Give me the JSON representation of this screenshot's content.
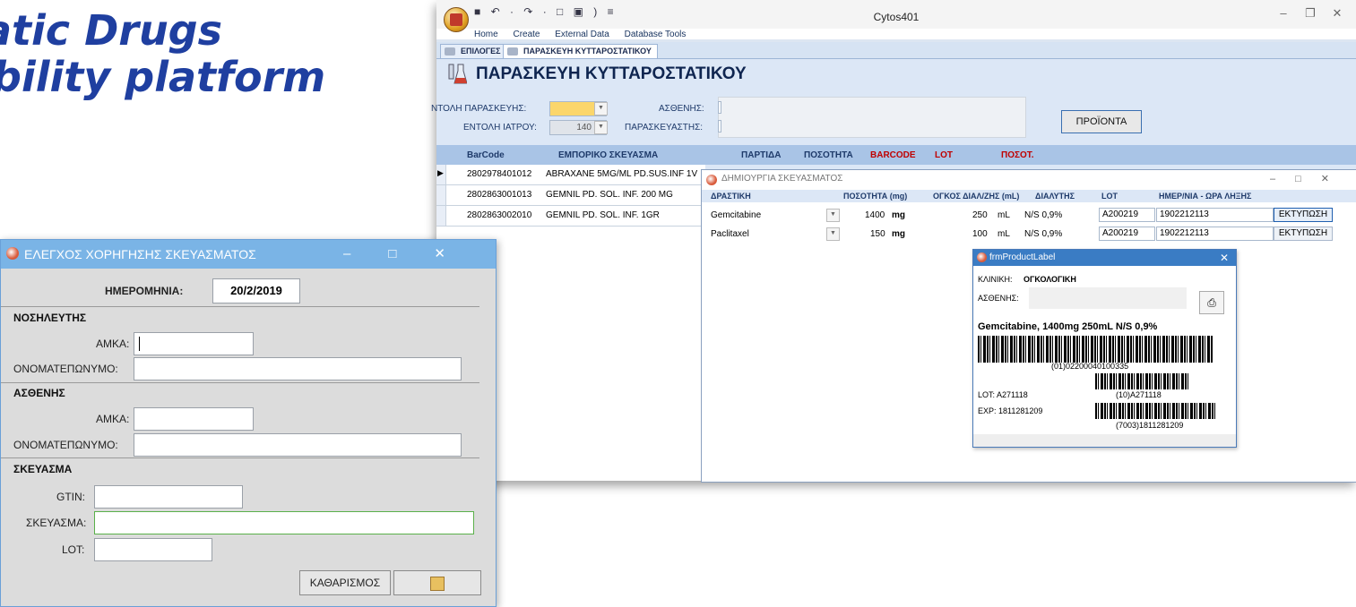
{
  "slide": {
    "line1": "tatic Drugs",
    "line2": "ability platform"
  },
  "main_window": {
    "title": "Cytos401",
    "quick_access": "■ ↶ · ↷ · □ ▣ ) ≡",
    "ribbon_tabs": [
      "Home",
      "Create",
      "External Data",
      "Database Tools"
    ],
    "doc_tabs": [
      "ΕΠΙΛΟΓΕΣ",
      "ΠΑΡΑΣΚΕΥΗ ΚΥΤΤΑΡΟΣΤΑΤΙΚΟΥ"
    ],
    "form_title": "ΠΑΡΑΣΚΕΥΗ ΚΥΤΤΑΡΟΣΤΑΤΙΚΟΥ",
    "fields": {
      "prep_label": "ΝΤΟΛΗ ΠΑΡΑΣΚΕΥΗΣ:",
      "doctor_order_label": "ΕΝΤΟΛΗ ΙΑΤΡΟΥ:",
      "doctor_order_value": "140",
      "patient_label": "ΑΣΘΕΝΗΣ:",
      "preparer_label": "ΠΑΡΑΣΚΕΥΑΣΤΗΣ:"
    },
    "products_button": "ΠΡΟΪΟΝΤΑ",
    "grid_headers": [
      "BarCode",
      "ΕΜΠΟΡΙΚΟ ΣΚΕΥΑΣΜΑ",
      "ΠΑΡΤΙΔΑ",
      "ΠΟΣΟΤΗΤΑ",
      "BARCODE",
      "LOT",
      "ΠΟΣΟΤ."
    ],
    "grid_rows": [
      {
        "barcode": "2802978401012",
        "name": "ABRAXANE 5MG/ML PD.SUS.INF 1V"
      },
      {
        "barcode": "2802863001013",
        "name": "GEMNIL PD. SOL. INF. 200 MG"
      },
      {
        "barcode": "2802863002010",
        "name": "GEMNIL PD. SOL. INF. 1GR"
      }
    ]
  },
  "prep_window": {
    "title": "ΔΗΜΙΟΥΡΓΙΑ ΣΚΕΥΑΣΜΑΤΟΣ",
    "headers": [
      "ΔΡΑΣΤΙΚΗ",
      "ΠΟΣΟΤΗΤΑ (mg)",
      "ΟΓΚΟΣ ΔΙΑΛ/ΖΗΣ (mL)",
      "ΔΙΑΛΥΤΗΣ",
      "LOT",
      "ΗΜΕΡ/ΝΙΑ - ΩΡΑ ΛΗΞΗΣ"
    ],
    "rows": [
      {
        "substance": "Gemcitabine",
        "qty": "1400",
        "qty_unit": "mg",
        "vol": "250",
        "vol_unit": "mL",
        "solvent": "N/S 0,9%",
        "lot": "A200219",
        "expiry": "1902212113",
        "print": "ΕΚΤΥΠΩΣΗ"
      },
      {
        "substance": "Paclitaxel",
        "qty": "150",
        "qty_unit": "mg",
        "vol": "100",
        "vol_unit": "mL",
        "solvent": "N/S 0,9%",
        "lot": "A200219",
        "expiry": "1902212113",
        "print": "ΕΚΤΥΠΩΣΗ"
      }
    ]
  },
  "label_window": {
    "title": "frmProductLabel",
    "clinic_label": "ΚΛΙΝΙΚΗ:",
    "clinic_value": "ΟΓΚΟΛΟΓΙΚΗ",
    "patient_label": "ΑΣΘΕΝΗΣ:",
    "product_line": "Gemcitabine, 1400mg 250mL N/S 0,9%",
    "gtin_code": "(01)02200040100335",
    "lot_code": "(10)A271118",
    "exp_code": "(7003)1811281209",
    "lot_line": "LOT: A271118",
    "exp_line": "EXP: 1811281209"
  },
  "check_window": {
    "title": "ΕΛΕΓΧΟΣ ΧΟΡΗΓΗΣΗΣ ΣΚΕΥΑΣΜΑΤΟΣ",
    "date_label": "ΗΜΕΡΟΜΗΝΙΑ:",
    "date_value": "20/2/2019",
    "nurse_section": "ΝΟΣΗΛΕΥΤΗΣ",
    "amka_label": "ΑΜΚΑ:",
    "fullname_label": "ΟΝΟΜΑΤΕΠΩΝΥΜΟ:",
    "patient_section": "ΑΣΘΕΝΗΣ",
    "product_section": "ΣΚΕΥΑΣΜΑ",
    "gtin_label": "GTIN:",
    "product_label": "ΣΚΕΥΑΣΜΑ:",
    "lot_label": "LOT:",
    "clear_button": "ΚΑΘΑΡΙΣΜΟΣ"
  },
  "colors": {
    "slide_title": "#1f3fa0",
    "label_titlebar": "#3a7cc4",
    "check_titlebar": "#7ab4e6",
    "grid_header": "#a9c4e6",
    "red_header": "#c00000"
  }
}
